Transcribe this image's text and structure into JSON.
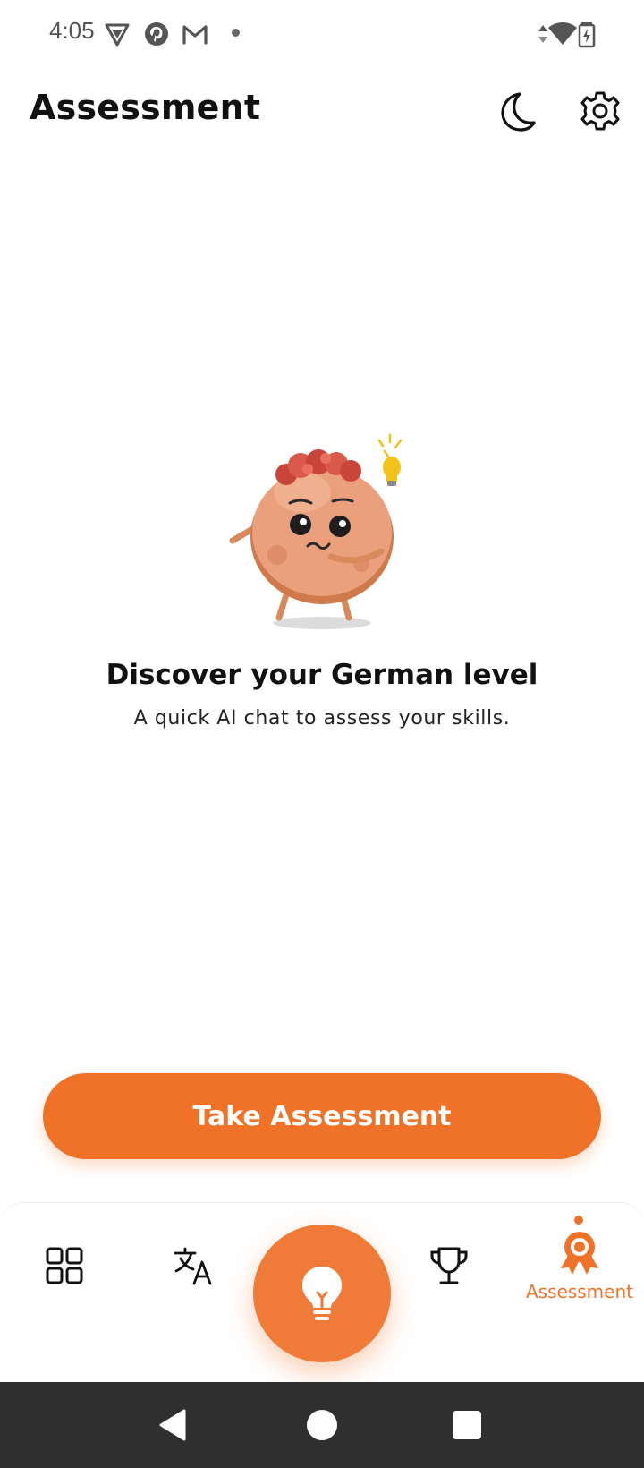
{
  "status_bar": {
    "time": "4:05",
    "left_icons": [
      "vpn-shield-icon",
      "pinterest-icon",
      "gmail-icon",
      "notification-dot-icon"
    ],
    "right_icons": [
      "data-arrows-icon",
      "wifi-icon",
      "battery-charging-icon"
    ]
  },
  "app_bar": {
    "title": "Assessment",
    "actions": [
      "dark-mode-moon-icon",
      "settings-gear-icon"
    ]
  },
  "main": {
    "illustration": "mascot-thinking-icon",
    "headline": "Discover your German level",
    "subtitle": "A quick AI chat to assess your skills.",
    "cta_label": "Take Assessment"
  },
  "bottom_nav": {
    "items": [
      {
        "icon": "grid-icon",
        "label": ""
      },
      {
        "icon": "translate-icon",
        "label": ""
      },
      {
        "icon": "lightbulb-icon",
        "label": ""
      },
      {
        "icon": "trophy-icon",
        "label": ""
      },
      {
        "icon": "award-badge-icon",
        "label": "Assessment"
      }
    ],
    "active_index": 4
  },
  "system_nav": [
    "back-icon",
    "home-icon",
    "recents-icon"
  ],
  "colors": {
    "accent": "#f07229",
    "text": "#111111",
    "system_nav_bg": "#2f2f2f"
  }
}
